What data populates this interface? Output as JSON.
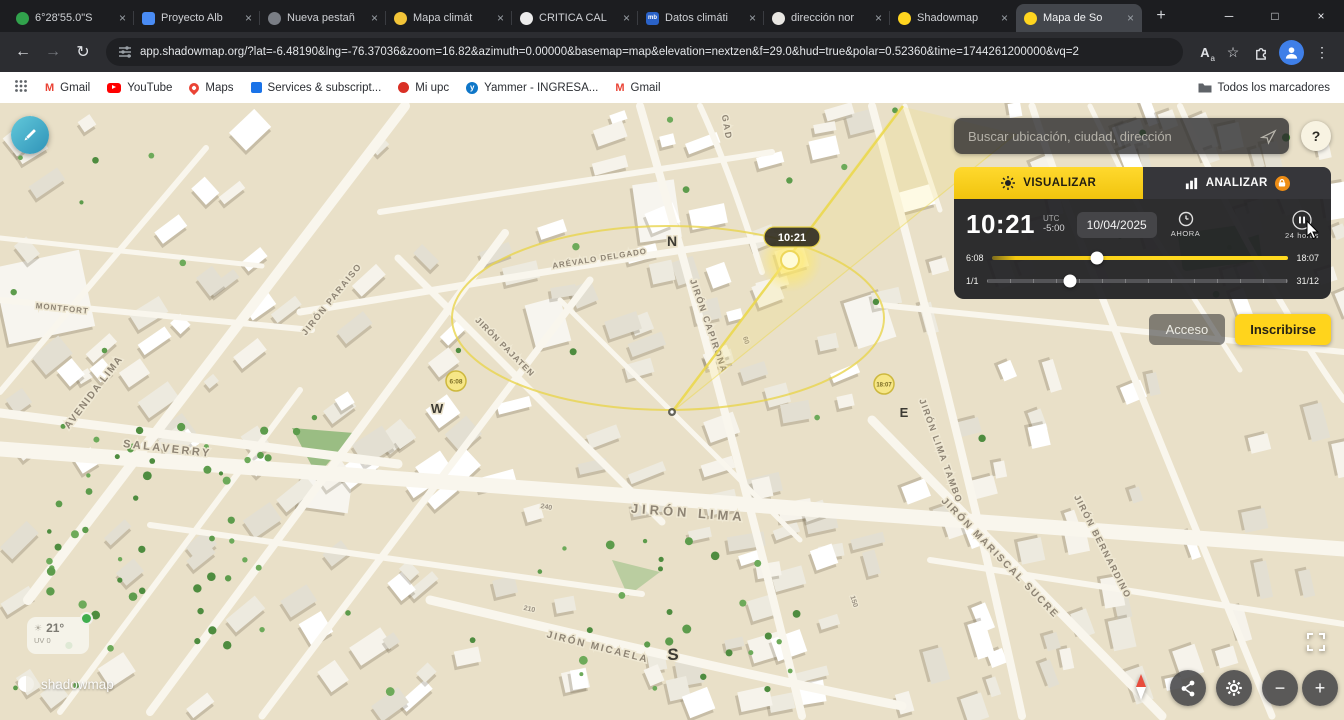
{
  "browser": {
    "tabs": [
      {
        "label": "6°28'55.0\"S",
        "icon": "maps-favicon"
      },
      {
        "label": "Proyecto Alb",
        "icon": "project-favicon"
      },
      {
        "label": "Nueva pestañ",
        "icon": "newtab-favicon"
      },
      {
        "label": "Mapa climát",
        "icon": "climate-favicon"
      },
      {
        "label": "CRITICA CAL",
        "icon": "chat-favicon"
      },
      {
        "label": "Datos climáti",
        "icon": "meteoblue-favicon"
      },
      {
        "label": "dirección nor",
        "icon": "doc-favicon"
      },
      {
        "label": "Shadowmap",
        "icon": "shadowmap-favicon"
      },
      {
        "label": "Mapa de So",
        "icon": "shadowmap-favicon"
      }
    ],
    "url": "app.shadowmap.org/?lat=-6.48190&lng=-76.37036&zoom=16.82&azimuth=0.00000&basemap=map&elevation=nextzen&f=29.0&hud=true&polar=0.52360&time=1744261200000&vq=2",
    "bookmarks": {
      "items": [
        {
          "label": "Gmail",
          "icon": "gmail-icon"
        },
        {
          "label": "YouTube",
          "icon": "youtube-icon"
        },
        {
          "label": "Maps",
          "icon": "maps-pin-icon"
        },
        {
          "label": "Services & subscript...",
          "icon": "services-icon"
        },
        {
          "label": "Mi upc",
          "icon": "upc-icon"
        },
        {
          "label": "Yammer - INGRESA...",
          "icon": "yammer-icon"
        },
        {
          "label": "Gmail",
          "icon": "gmail-icon"
        }
      ],
      "all_label": "Todos los marcadores"
    }
  },
  "shadowmap": {
    "search": {
      "placeholder": "Buscar ubicación, ciudad, dirección"
    },
    "help": "?",
    "tabs": {
      "visualize": "VISUALIZAR",
      "analyze": "ANALIZAR"
    },
    "time_panel": {
      "time": "10:21",
      "utc": "UTC",
      "offset": "-5:00",
      "date": "10/04/2025",
      "now": "AHORA",
      "hours": "24 horas",
      "time_start": "6:08",
      "time_end": "18:07",
      "date_start": "1/1",
      "date_end": "31/12"
    },
    "auth": {
      "login": "Acceso",
      "signup": "Inscribirse"
    },
    "watermark": "shadowmap",
    "weather": {
      "temp": "21°",
      "uv": "UV 0"
    }
  },
  "map": {
    "streets": [
      {
        "name": "JIRÓN LIMA"
      },
      {
        "name": "SALAVERRY"
      },
      {
        "name": "AVENIDA LIMA"
      },
      {
        "name": "JIRÓN PARAISO"
      },
      {
        "name": "JIRÓN PAJATEN"
      },
      {
        "name": "JIRÓN CAPIRONA"
      },
      {
        "name": "ARÉVALO DELGADO"
      },
      {
        "name": "JIRÓN MICAELA"
      },
      {
        "name": "JIRÓN MARISCAL SUCRE"
      },
      {
        "name": "JIRÓN LIMA TAMBO"
      },
      {
        "name": "JIRÓN BERNARDINO"
      },
      {
        "name": "MONTFORT"
      },
      {
        "name": "GAD"
      }
    ],
    "road_numbers": [
      "240",
      "210",
      "60",
      "150"
    ],
    "compass": {
      "n": "N",
      "w": "W",
      "s": "S",
      "e": "E"
    },
    "sun": {
      "current": "10:21",
      "sunrise": "6:08",
      "sunset": "18:07"
    }
  },
  "icons": {
    "back": "←",
    "forward": "→",
    "reload": "↻",
    "star": "☆",
    "overflow_menu": "⋮",
    "new_tab": "+",
    "minimize": "─",
    "maximize": "□",
    "close": "×",
    "tab_close": "×",
    "zoom_in": "+",
    "zoom_out": "−",
    "gmail_m": "M",
    "yammer_y": "y",
    "meteoblue_mb": "mb",
    "translate_primary": "A",
    "translate_secondary": "a",
    "weather_sun": "☀"
  }
}
